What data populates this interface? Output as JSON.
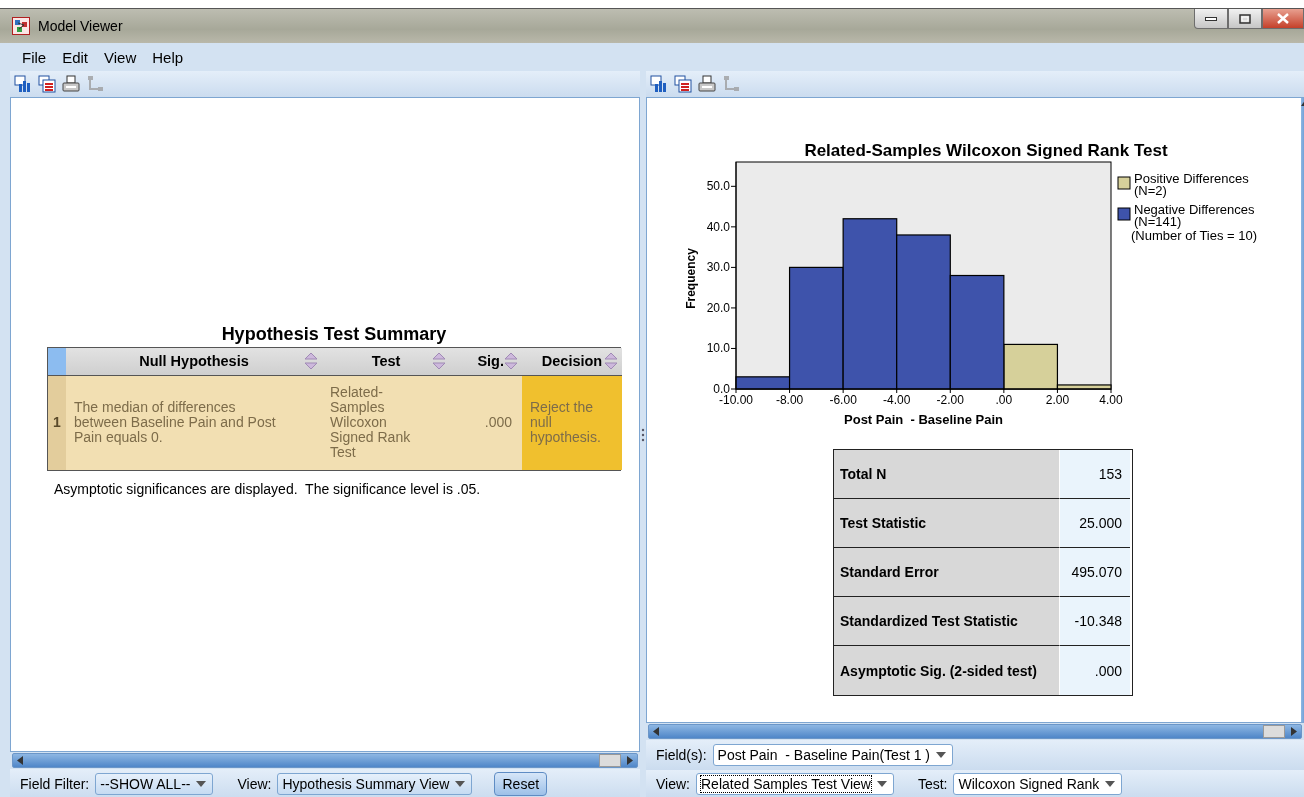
{
  "window": {
    "title": "Model Viewer"
  },
  "menu": [
    {
      "label": "File"
    },
    {
      "label": "Edit"
    },
    {
      "label": "View"
    },
    {
      "label": "Help"
    }
  ],
  "left_pane": {
    "toolbar": [
      {
        "kind": "chart",
        "disabled": false
      },
      {
        "kind": "table",
        "disabled": false
      },
      {
        "kind": "print",
        "disabled": false
      },
      {
        "kind": "tree",
        "disabled": true
      }
    ],
    "title": "Hypothesis Test Summary",
    "table": {
      "columns": [
        "Null Hypothesis",
        "Test",
        "Sig.",
        "Decision"
      ],
      "rows": [
        {
          "index": "1",
          "rejected": true,
          "cells": [
            "The median of differences between Baseline Pain and Post Pain equals 0.",
            "Related-Samples Wilcoxon Signed Rank Test",
            ".000",
            "Reject the null hypothesis."
          ]
        }
      ]
    },
    "footnote": "Asymptotic significances are displayed.  The significance level is .05.",
    "controls": [
      {
        "kind": "combo",
        "label": "Field Filter:",
        "value": "--SHOW ALL--",
        "focused": false
      },
      {
        "kind": "combo",
        "label": "View:",
        "value": "Hypothesis Summary View",
        "focused": false
      },
      {
        "kind": "button",
        "label": "Reset"
      }
    ]
  },
  "right_pane": {
    "toolbar": [
      {
        "kind": "chart",
        "disabled": false
      },
      {
        "kind": "table",
        "disabled": false
      },
      {
        "kind": "print",
        "disabled": false
      },
      {
        "kind": "tree",
        "disabled": true
      }
    ],
    "chart": {
      "chart_data": {
        "type": "bar",
        "title": "Related-Samples Wilcoxon Signed Rank Test",
        "xlabel": "Post Pain  - Baseline Pain",
        "ylabel": "Frequency",
        "x": [
          -9,
          -7,
          -5,
          -3,
          -1,
          1,
          3
        ],
        "series": [
          {
            "name": "Positive Differences",
            "color": "#d6d09a",
            "values": [
              null,
              null,
              null,
              null,
              null,
              11,
              1
            ]
          },
          {
            "name": "Negative Differences",
            "color": "#3e53ab",
            "values": [
              3,
              30,
              42,
              38,
              28,
              null,
              null
            ]
          }
        ],
        "legend": true,
        "xlim": [
          -10,
          4
        ],
        "ylim": [
          0,
          56
        ],
        "xticks": [
          {
            "value": -10,
            "label": "-10.00"
          },
          {
            "value": -8,
            "label": "-8.00"
          },
          {
            "value": -6,
            "label": "-6.00"
          },
          {
            "value": -4,
            "label": "-4.00"
          },
          {
            "value": -2,
            "label": "-2.00"
          },
          {
            "value": 0,
            "label": ".00"
          },
          {
            "value": 2,
            "label": "2.00"
          },
          {
            "value": 4,
            "label": "4.00"
          }
        ],
        "yticks": [
          {
            "value": 0,
            "label": "0.0"
          },
          {
            "value": 10,
            "label": "10.0"
          },
          {
            "value": 20,
            "label": "20.0"
          },
          {
            "value": 30,
            "label": "30.0"
          },
          {
            "value": 40,
            "label": "40.0"
          },
          {
            "value": 50,
            "label": "50.0"
          }
        ]
      },
      "legend_counts": [
        "(N=2)",
        "(N=141)"
      ],
      "note": "(Number of Ties = 10)"
    },
    "stats": [
      {
        "label": "Total N",
        "value": "153"
      },
      {
        "label": "Test Statistic",
        "value": "25.000"
      },
      {
        "label": "Standard Error",
        "value": "495.070"
      },
      {
        "label": "Standardized Test Statistic",
        "value": "-10.348"
      },
      {
        "label": "Asymptotic Sig. (2-sided test)",
        "value": ".000"
      }
    ],
    "field_controls": [
      {
        "kind": "combo",
        "label": "Field(s):",
        "value": "Post Pain  - Baseline Pain(Test 1 )",
        "focused": false
      }
    ],
    "view_controls": [
      {
        "kind": "combo",
        "label": "View:",
        "value": "Related Samples Test View",
        "focused": true
      },
      {
        "kind": "combo",
        "label": "Test:",
        "value": "Wilcoxon Signed Rank",
        "focused": false
      }
    ]
  }
}
